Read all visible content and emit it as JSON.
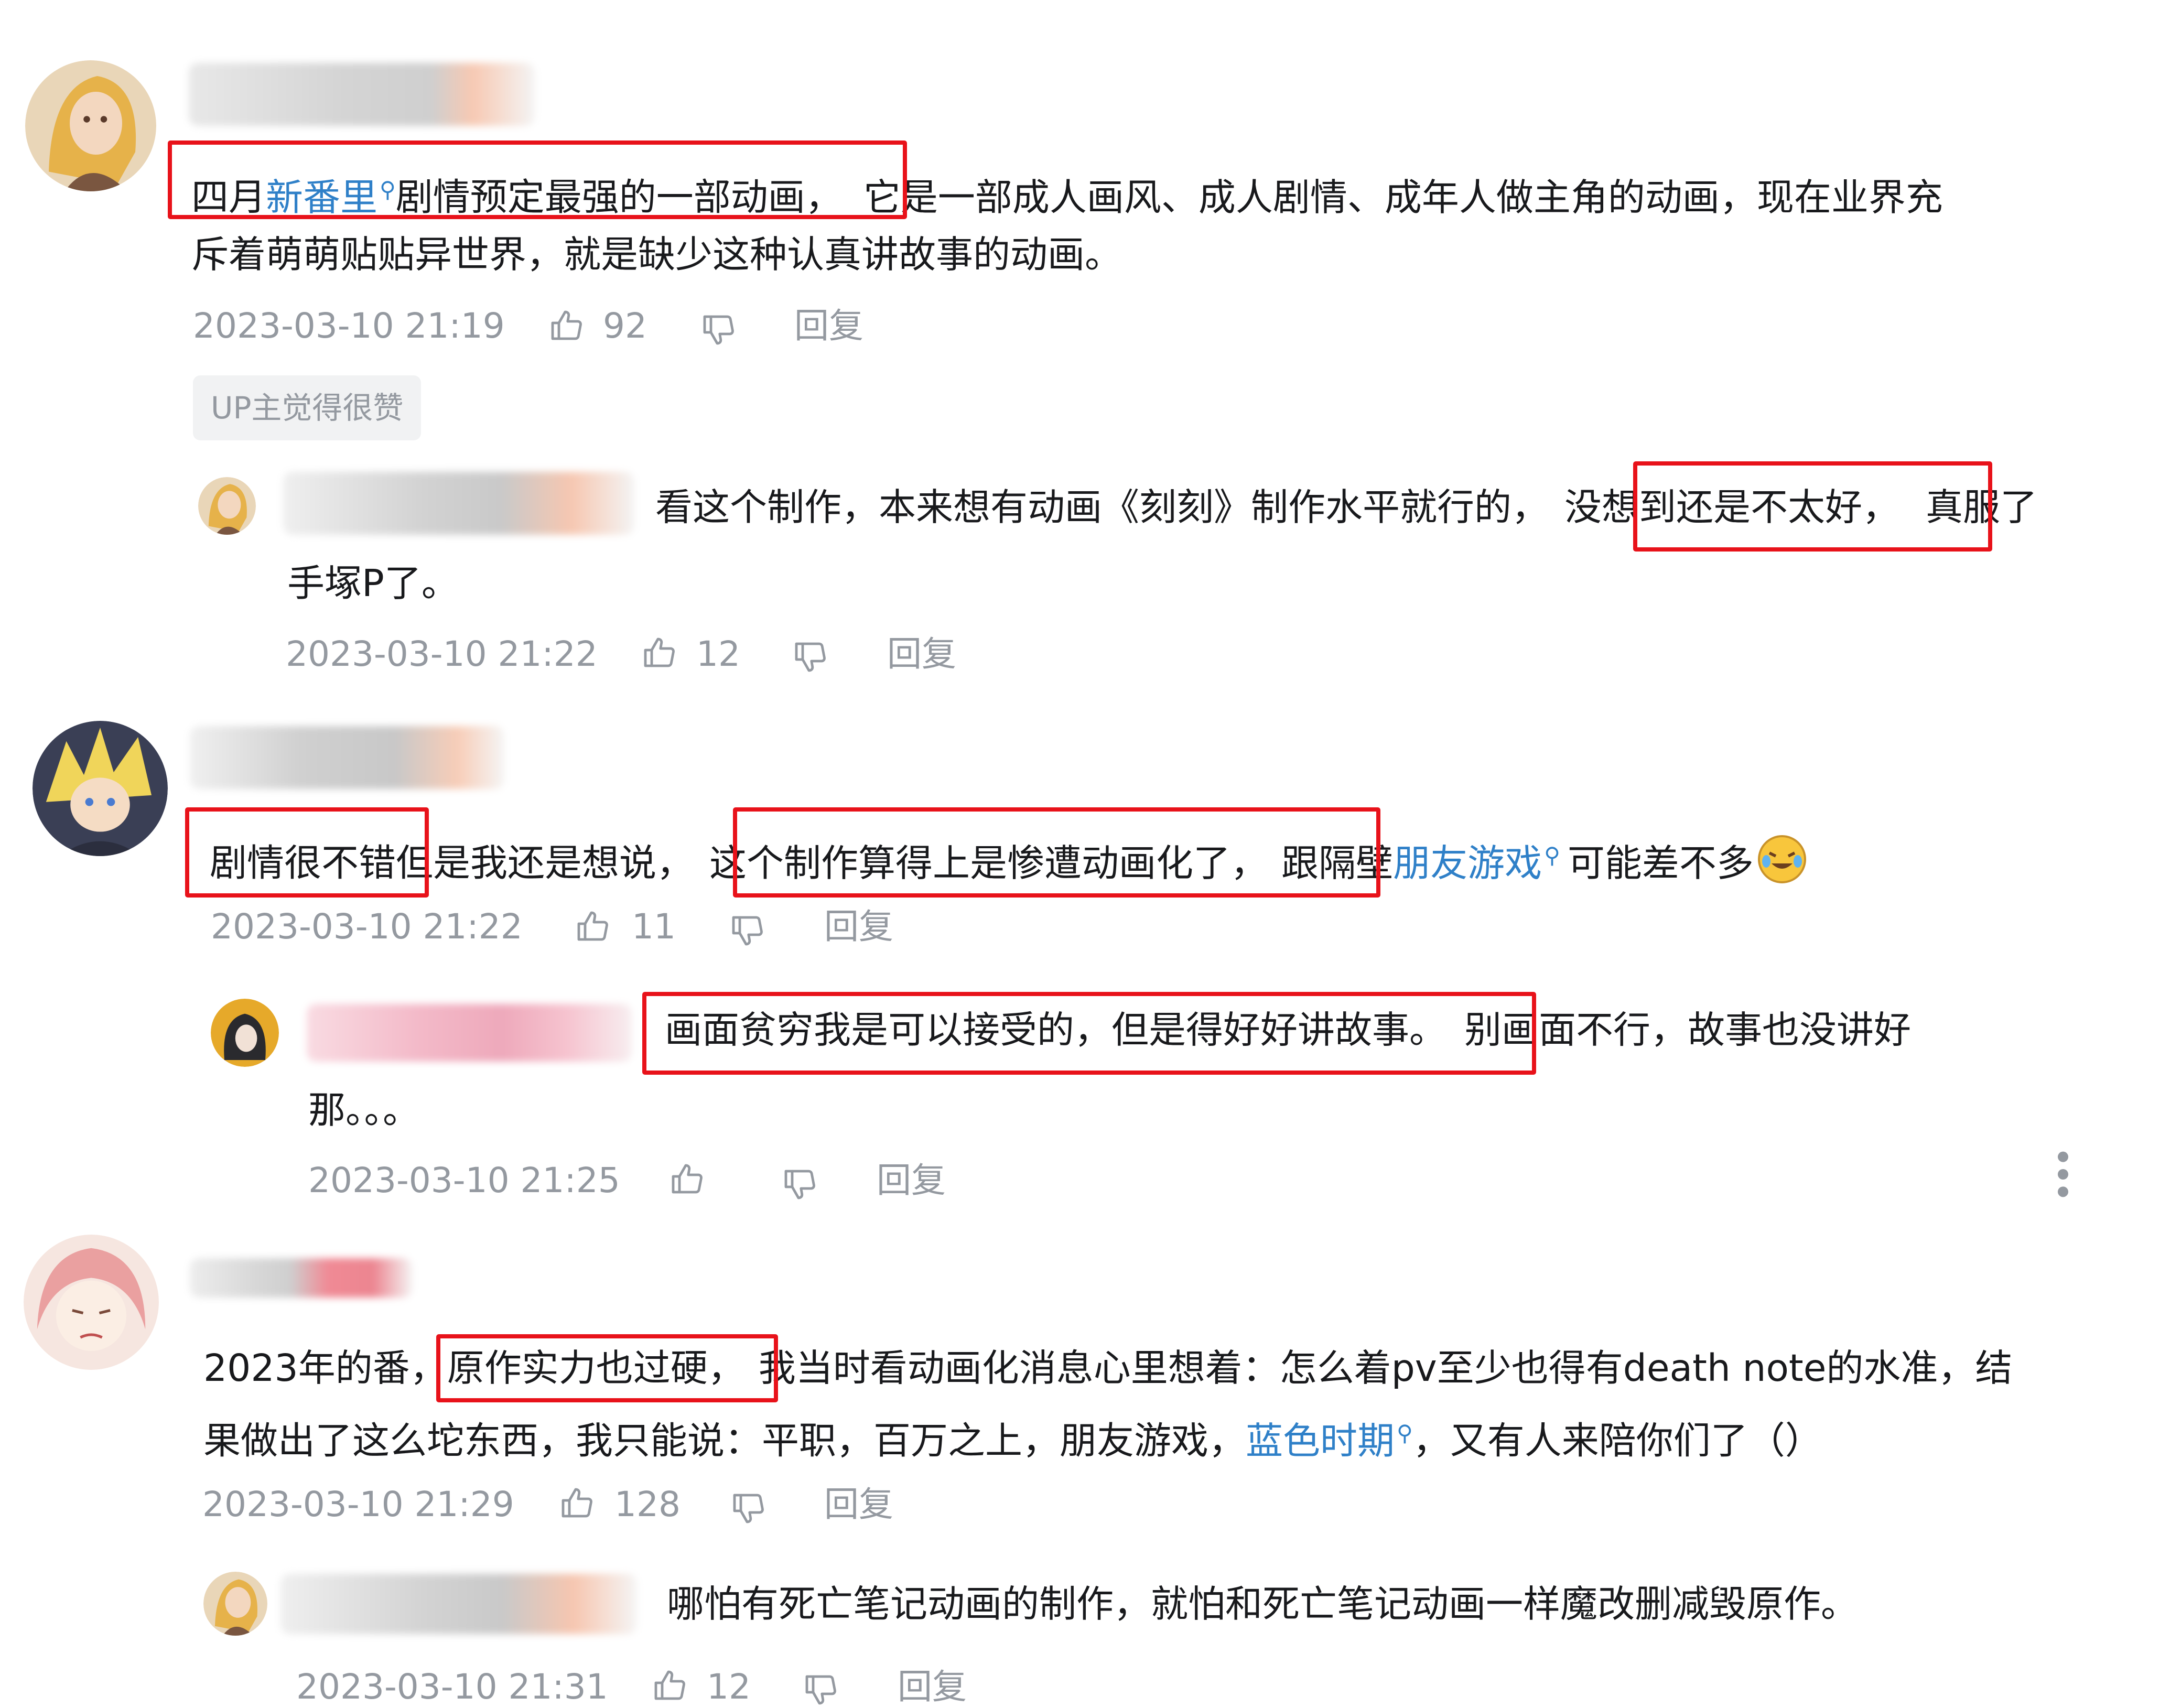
{
  "comments": [
    {
      "text": {
        "t1": "四月",
        "link1": "新番里",
        "t2": "剧情预定最强的一部动画，",
        "t3": "它是一部成人画风、成人剧情、成年人做主角的动画，现在业界充",
        "line2": "斥着萌萌贴贴异世界，就是缺少这种认真讲故事的动画。"
      },
      "time": "2023-03-10 21:19",
      "likes": "92",
      "reply_label": "回复",
      "badge": "UP主觉得很赞",
      "replies": [
        {
          "text": {
            "t1": "看这个制作，本来想有动画《刻刻》制作水平就行的，",
            "t2": "没想到还是不太好，",
            "t3": "真服了",
            "line2": "手塚P了。"
          },
          "time": "2023-03-10 21:22",
          "likes": "12",
          "reply_label": "回复"
        }
      ]
    },
    {
      "text": {
        "t1": "剧情很不错",
        "t2": "但是我还是想说，",
        "t3": "这个制作算得上是惨遭动画化了，",
        "t4": "跟隔壁",
        "link1": "朋友游戏",
        "t5": "可能差不多"
      },
      "time": "2023-03-10 21:22",
      "likes": "11",
      "reply_label": "回复",
      "replies": [
        {
          "text": {
            "t1": "画面贫穷我是可以接受的，但是得好好讲故事。",
            "t2": "别画面不行，故事也没讲好",
            "line2": "那。。。"
          },
          "time": "2023-03-10 21:25",
          "likes": "",
          "reply_label": "回复"
        }
      ]
    },
    {
      "text": {
        "t1": "2023年的番，",
        "t2": "原作实力也过硬，",
        "t3": "我当时看动画化消息心里想着：怎么着pv至少也得有death note的水准，结",
        "l2a": "果做出了这么坨东西，我只能说：平职，百万之上，朋友游戏，",
        "link1": "蓝色时期",
        "l2b": "，又有人来陪你们了（）"
      },
      "time": "2023-03-10 21:29",
      "likes": "128",
      "reply_label": "回复",
      "replies": [
        {
          "text": {
            "t1": "哪怕有死亡笔记动画的制作，就怕和死亡笔记动画一样魔改删减毁原作。"
          },
          "time": "2023-03-10 21:31",
          "likes": "12",
          "reply_label": "回复"
        }
      ]
    }
  ],
  "icons": {
    "like": "thumbs-up-icon",
    "dislike": "thumbs-down-icon",
    "search": "search-icon",
    "more": "more-vertical-icon"
  },
  "colors": {
    "highlight_box": "#e8121a",
    "link": "#2f80c8",
    "meta": "#9499a0"
  }
}
